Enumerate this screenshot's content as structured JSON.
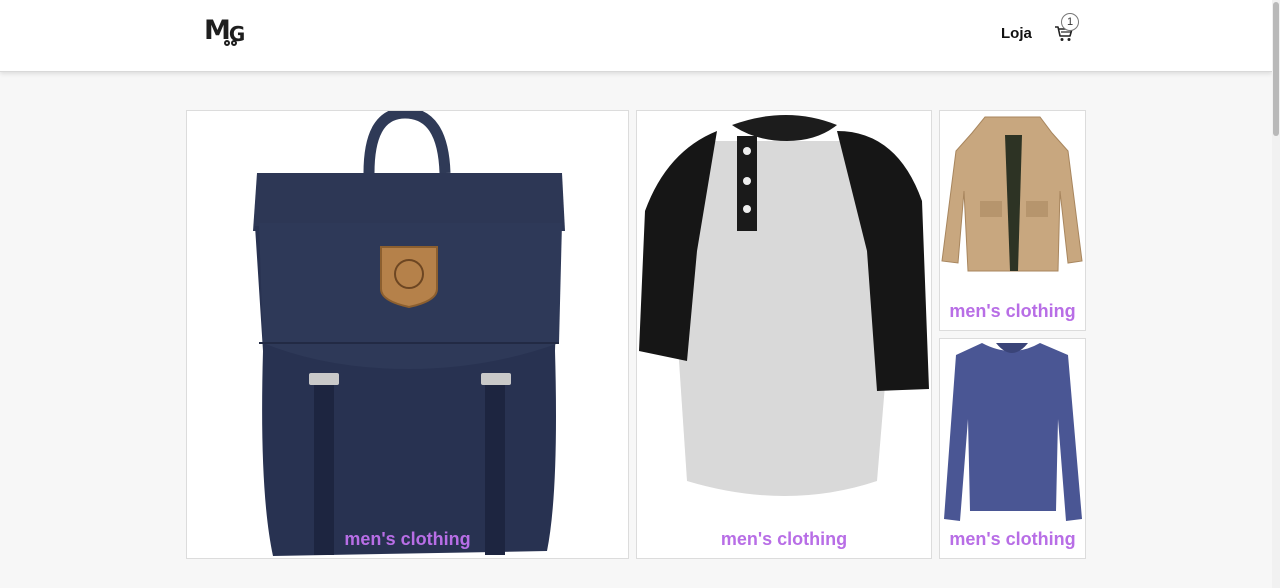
{
  "header": {
    "logo_text": "MG",
    "nav_link": "Loja",
    "cart_count": "1"
  },
  "products": [
    {
      "category": "men's clothing",
      "image": "navy-backpack"
    },
    {
      "category": "men's clothing",
      "image": "raglan-henley-shirt"
    },
    {
      "category": "men's clothing",
      "image": "khaki-jacket"
    },
    {
      "category": "men's clothing",
      "image": "blue-long-sleeve-shirt"
    }
  ],
  "colors": {
    "label": "#b86ee6",
    "backpack": "#2b3552",
    "card_border": "#dcdcdc"
  }
}
